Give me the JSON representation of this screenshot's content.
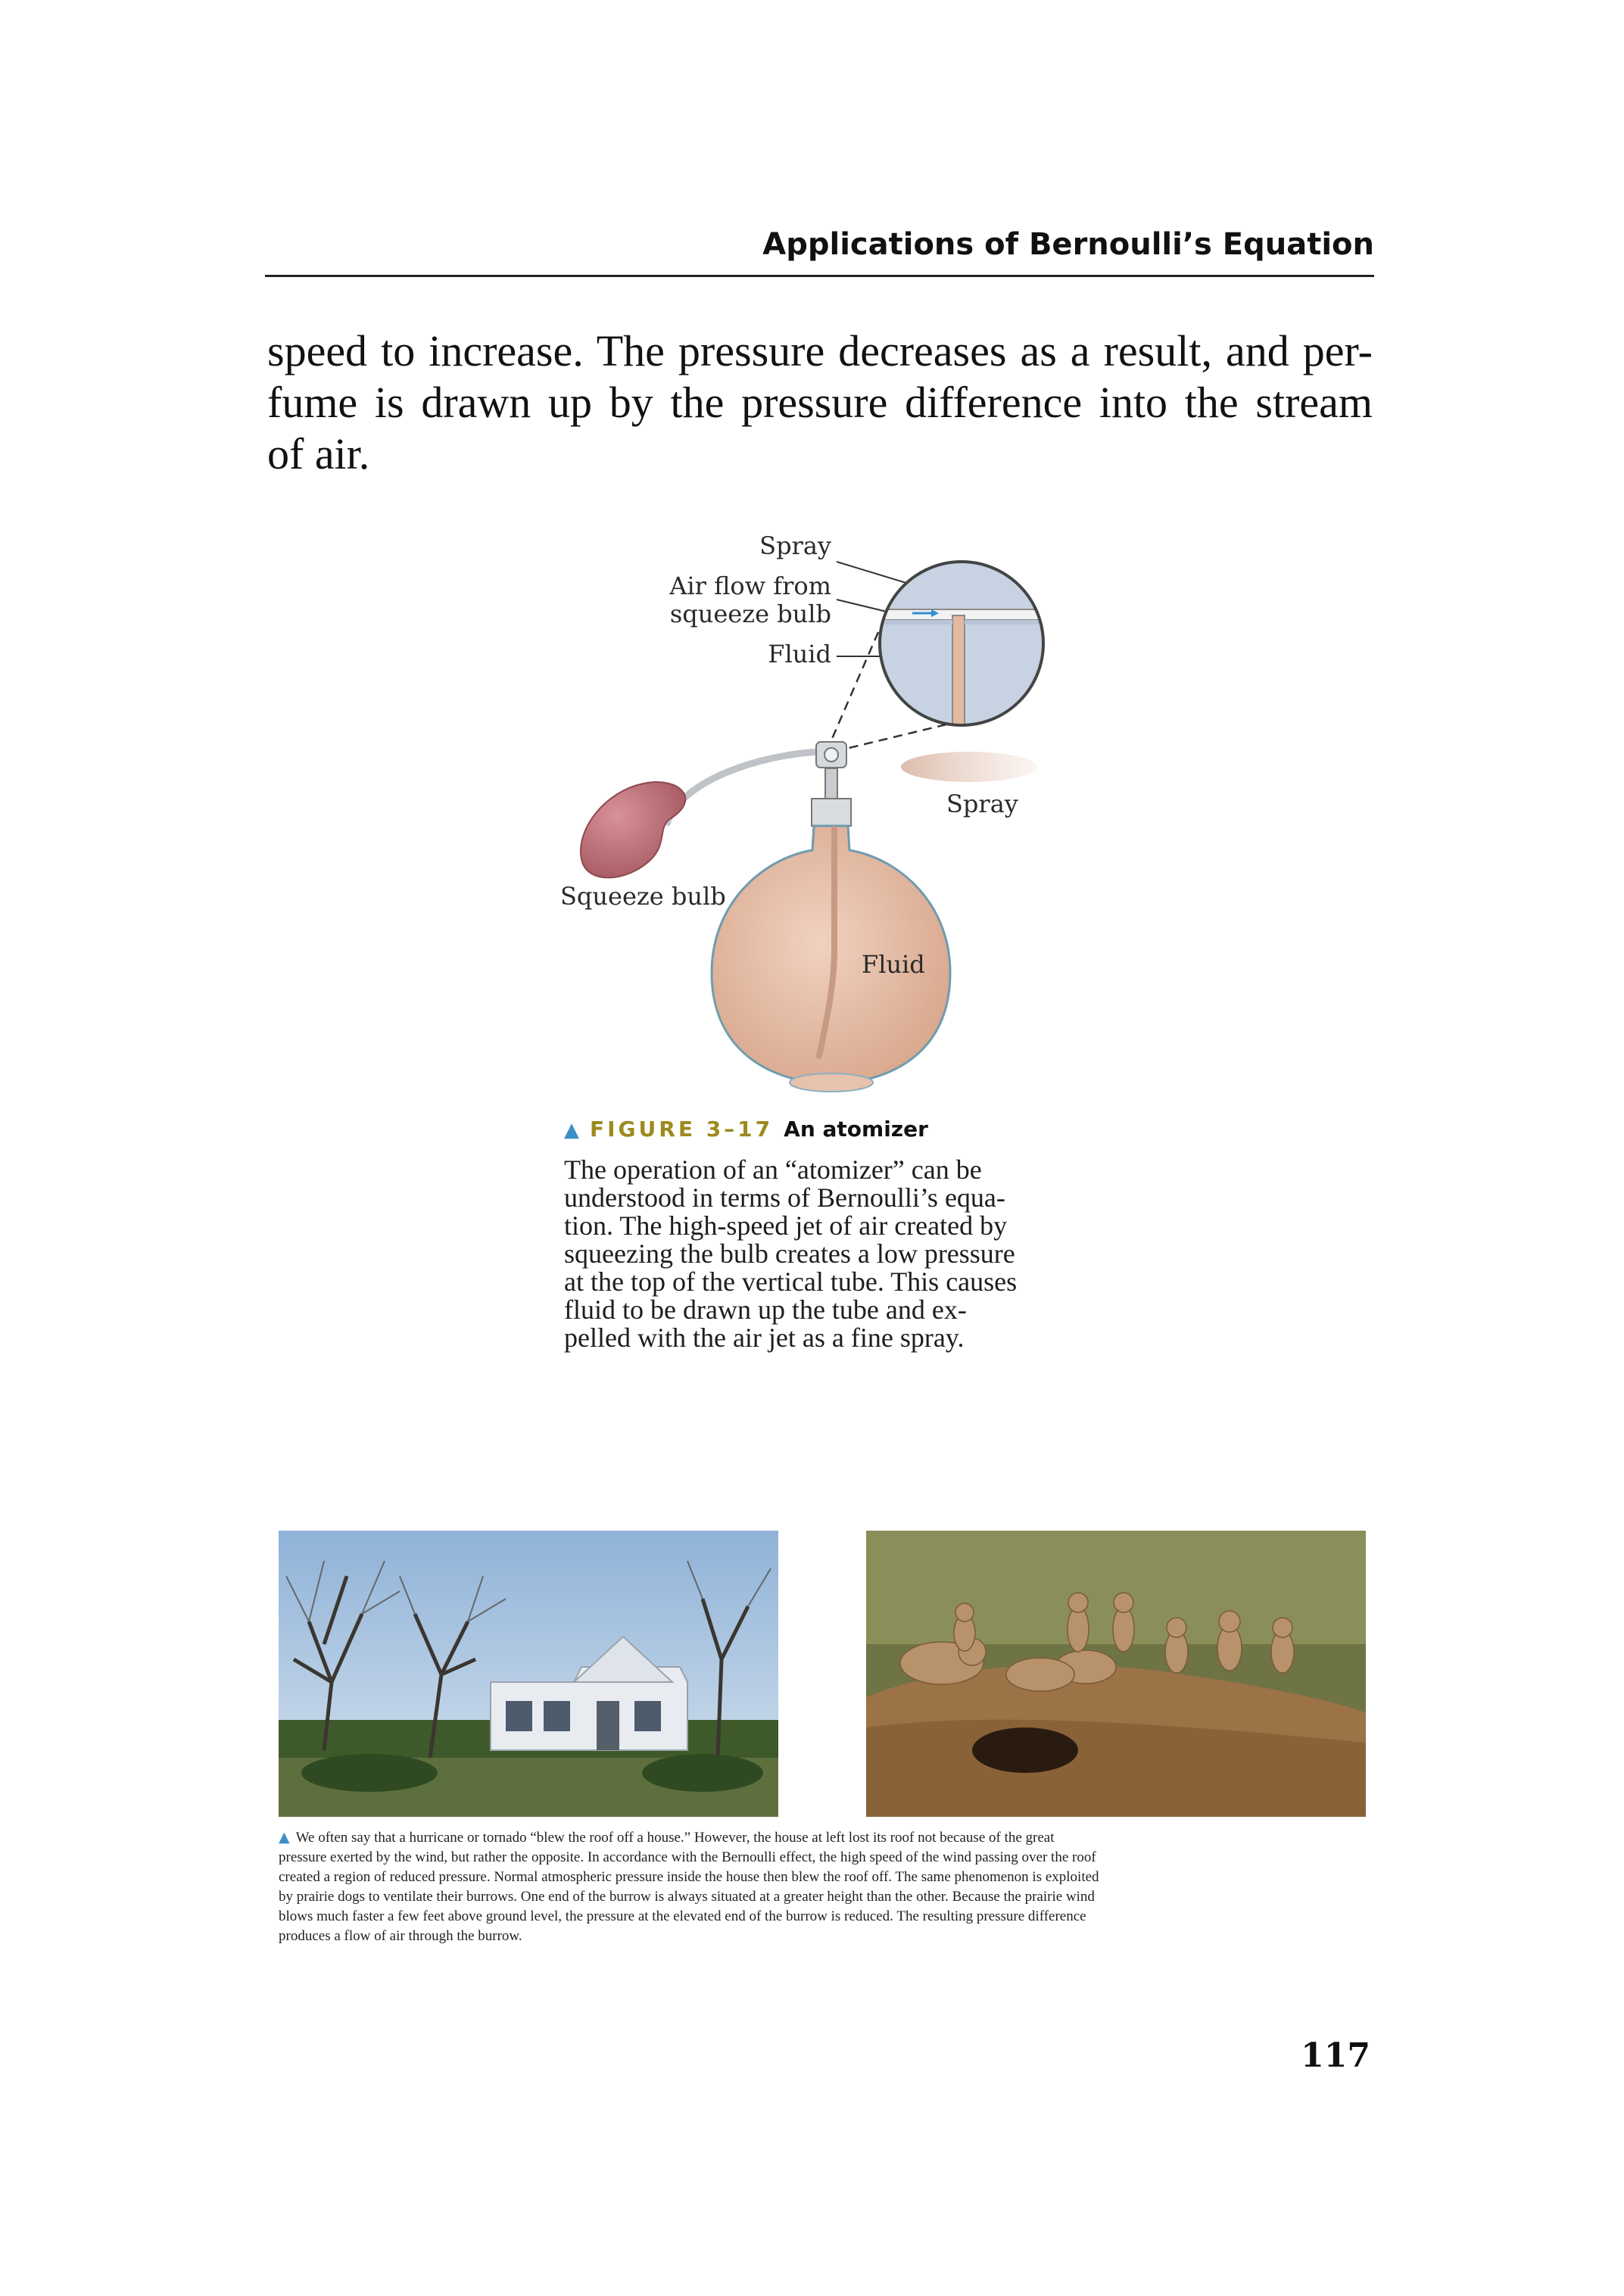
{
  "running_head": "Applications of Bernoulli’s Equation",
  "body_lines": [
    "speed to increase. The pressure decreases as a result, and per-",
    "fume is drawn up by the pressure difference into the stream",
    "of air."
  ],
  "figure": {
    "labels": {
      "spray_top": "Spray",
      "air_flow_1": "Air flow from",
      "air_flow_2": "squeeze bulb",
      "fluid_top": "Fluid",
      "spray_right": "Spray",
      "squeeze_bulb": "Squeeze bulb",
      "fluid_bottle": "Fluid"
    },
    "caption_number": "FIGURE 3–17",
    "caption_title": "An atomizer",
    "caption_lines": [
      "The operation of an “atomizer” can be",
      "understood in terms of Bernoulli’s equa-",
      "tion. The high-speed jet of air created by",
      "squeezing the bulb creates a low pressure",
      "at the top of the vertical tube. This causes",
      "fluid to be drawn up the tube and ex-",
      "pelled with the air jet as a fine spray."
    ],
    "colors": {
      "bottle_fluid": "#e3b9a1",
      "bulb": "#c4737a",
      "inset_bg": "#c7d3e3",
      "accent_triangle": "#3b8fc8",
      "figure_number": "#9c8a1d"
    }
  },
  "photos": {
    "left": "house with roof blown off after storm",
    "right": "prairie dogs at burrow entrance"
  },
  "photo_caption_lines": [
    "We often say that a hurricane or tornado “blew the roof off a house.” However, the house at left lost its roof not because of the great",
    "pressure exerted by the wind, but rather the opposite. In accordance with the Bernoulli effect, the high speed of the wind passing over the roof",
    "created a region of reduced pressure. Normal atmospheric pressure inside the house then blew the roof off. The same phenomenon is exploited",
    "by prairie dogs to ventilate their burrows. One end of the burrow is always situated at a greater height than the other. Because the prairie wind",
    "blows much faster a few feet above ground level, the pressure at the elevated end of the burrow is reduced. The resulting pressure difference",
    "produces a flow of air through the burrow."
  ],
  "page_number": "117"
}
